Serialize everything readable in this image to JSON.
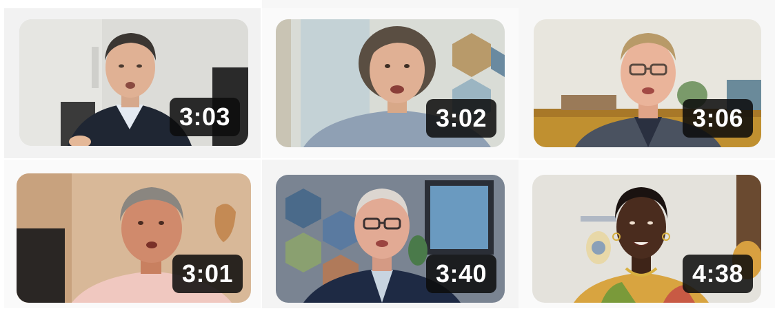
{
  "video_grid": {
    "videos": [
      {
        "duration": "3:03"
      },
      {
        "duration": "3:02"
      },
      {
        "duration": "3:06"
      },
      {
        "duration": "3:01"
      },
      {
        "duration": "3:40"
      },
      {
        "duration": "4:38"
      }
    ]
  }
}
